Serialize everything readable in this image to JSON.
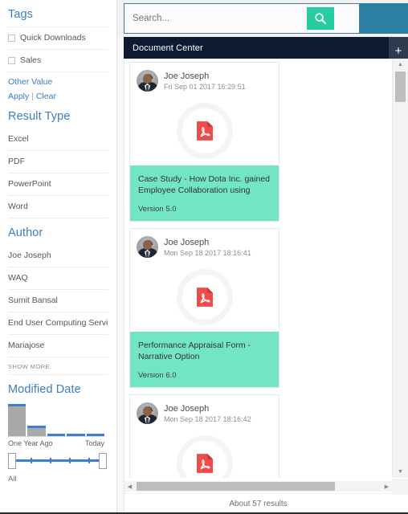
{
  "sidebar": {
    "tags": {
      "title": "Tags",
      "items": [
        {
          "label": "Quick Downloads"
        },
        {
          "label": "Sales"
        }
      ],
      "other_value": "Other Value",
      "apply": "Apply",
      "separator": "|",
      "clear": "Clear"
    },
    "result_type": {
      "title": "Result Type",
      "items": [
        {
          "label": "Excel"
        },
        {
          "label": "PDF"
        },
        {
          "label": "PowerPoint"
        },
        {
          "label": "Word"
        }
      ]
    },
    "author": {
      "title": "Author",
      "items": [
        {
          "label": "Joe Joseph"
        },
        {
          "label": "WAQ"
        },
        {
          "label": "Sumit Bansal"
        },
        {
          "label": "End User Computing Servi..."
        },
        {
          "label": "Mariajose"
        }
      ],
      "show_more": "SHOW MORE"
    },
    "modified_date": {
      "title": "Modified Date",
      "axis_left": "One Year Ago",
      "axis_right": "Today",
      "range_label": "All"
    }
  },
  "header": {
    "search": {
      "placeholder": "Search...",
      "value": "",
      "button_icon": "search-icon",
      "button_color": "#27cca2"
    },
    "right_panel_color": "#2b7fa3"
  },
  "doc_center": {
    "title": "Document Center",
    "add_label": "+",
    "bar_color": "#0d1a32"
  },
  "results": {
    "cards": [
      {
        "author": "Joe Joseph",
        "date": "Fri Sep 01 2017 16:29:51",
        "icon": "pdf-icon",
        "title": "Case Study - How Dota Inc. gained Employee Collaboration using",
        "version": "Version 5.0",
        "body_color": "#72e5c4"
      },
      {
        "author": "Joe Joseph",
        "date": "Mon Sep 18 2017 18:16:41",
        "icon": "pdf-icon",
        "title": "Performance Appraisal Form - Narrative Option",
        "version": "Version 6.0",
        "body_color": "#72e5c4"
      },
      {
        "author": "Joe Joseph",
        "date": "Mon Sep 18 2017 18:16:42",
        "icon": "pdf-icon",
        "title": "",
        "version": "",
        "body_color": "#72e5c4"
      }
    ],
    "footer": "About 57 results",
    "scroll_up_icon": "▲",
    "scroll_down_icon": "▼",
    "scroll_left_icon": "◀",
    "scroll_right_icon": "▶"
  },
  "chart_data": {
    "type": "bar",
    "title": "Modified Date",
    "categories": [
      "b1",
      "b2",
      "b3",
      "b4",
      "b5"
    ],
    "values": [
      40,
      13,
      3,
      3,
      3
    ],
    "xlabel": "",
    "ylabel": "",
    "ylim": [
      0,
      44
    ],
    "axis_tick_labels": [
      "One Year Ago",
      "Today"
    ],
    "grid": false,
    "bar_color": "#a9a9a9",
    "bar_top_color": "#3c7fd0"
  }
}
